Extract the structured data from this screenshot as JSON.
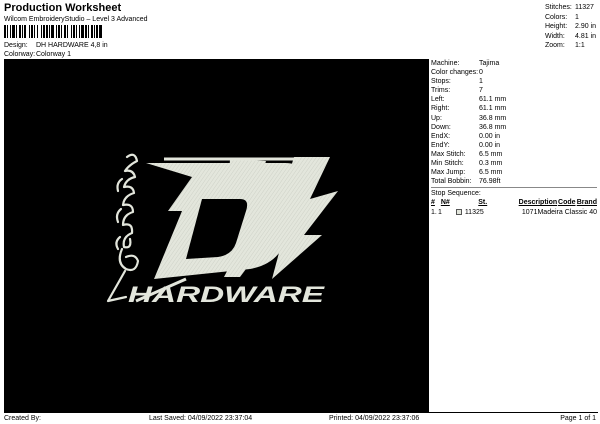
{
  "header": {
    "title": "Production Worksheet",
    "subtitle": "Wilcom EmbroideryStudio – Level 3 Advanced",
    "design_label": "Design:",
    "design_value": "DH HARDWARE 4,8 in",
    "colorway_label": "Colorway:",
    "colorway_value": "Colorway 1"
  },
  "summary": {
    "stitches_label": "Stitches:",
    "stitches": "11327",
    "colors_label": "Colors:",
    "colors": "1",
    "height_label": "Height:",
    "height": "2.90 in",
    "width_label": "Width:",
    "width": "4.81 in",
    "zoom_label": "Zoom:",
    "zoom": "1:1"
  },
  "info": [
    {
      "label": "Machine:",
      "value": "Tajima"
    },
    {
      "label": "Color changes:",
      "value": "0"
    },
    {
      "label": "Stops:",
      "value": "1"
    },
    {
      "label": "Trims:",
      "value": "7"
    },
    {
      "label": "Left:",
      "value": "61.1 mm"
    },
    {
      "label": "Right:",
      "value": "61.1 mm"
    },
    {
      "label": "Up:",
      "value": "36.8 mm"
    },
    {
      "label": "Down:",
      "value": "36.8 mm"
    },
    {
      "label": "EndX:",
      "value": "0.00 in"
    },
    {
      "label": "EndY:",
      "value": "0.00 in"
    },
    {
      "label": "Max Stitch:",
      "value": "6.5 mm"
    },
    {
      "label": "Min Stitch:",
      "value": "0.3 mm"
    },
    {
      "label": "Max Jump:",
      "value": "6.5 mm"
    },
    {
      "label": "Total Bobbin:",
      "value": "76.98ft"
    }
  ],
  "stop_sequence": {
    "title": "Stop Sequence:",
    "headers": [
      "#",
      "N#",
      "St.",
      "Description",
      "Code",
      "Brand"
    ],
    "rows": [
      {
        "idx": "1.",
        "n": "1",
        "st": "11325",
        "desc": "",
        "code": "1071",
        "brand": "Madeira Classic 40",
        "color": "#e3e6dc"
      }
    ]
  },
  "design_logo": {
    "monogram": "DH",
    "wordmark": "HARDWARE",
    "thread_color": "#e3e6dc",
    "background": "#000000"
  },
  "footer": {
    "created_by": "Created By:",
    "last_saved": "Last Saved: 04/09/2022 23:37:04",
    "printed": "Printed: 04/09/2022 23:37:06",
    "page": "Page 1 of 1"
  }
}
